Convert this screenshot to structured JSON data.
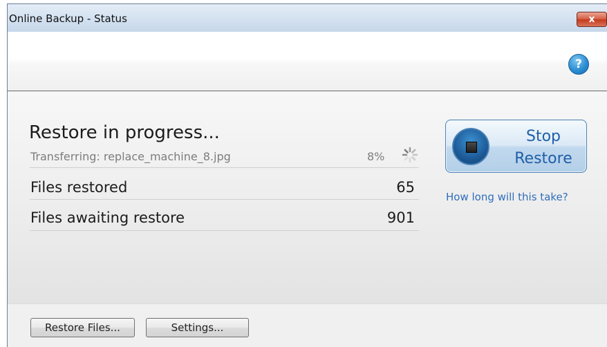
{
  "window": {
    "title": "Online Backup - Status",
    "close_label": "x"
  },
  "header": {
    "help_label": "?"
  },
  "status": {
    "heading": "Restore in progress...",
    "transfer_label": "Transferring: replace_machine_8.jpg",
    "transfer_percent": "8%",
    "progress_fraction": 0.08,
    "stats": [
      {
        "label": "Files restored",
        "value": "65"
      },
      {
        "label": "Files awaiting restore",
        "value": "901"
      }
    ]
  },
  "actions": {
    "stop_label_line1": "Stop",
    "stop_label_line2": "Restore",
    "how_long_link": "How long will this take?"
  },
  "footer": {
    "restore_files_label": "Restore Files...",
    "settings_label": "Settings..."
  },
  "colors": {
    "accent": "#2f6dbb",
    "stop_button_text": "#1f5fa8",
    "close_button": "#c3391c",
    "help_icon": "#2d8fd3"
  },
  "icons": {
    "help": "help-icon",
    "stop": "stop-icon",
    "spinner": "spinner-icon",
    "close": "close-icon"
  }
}
